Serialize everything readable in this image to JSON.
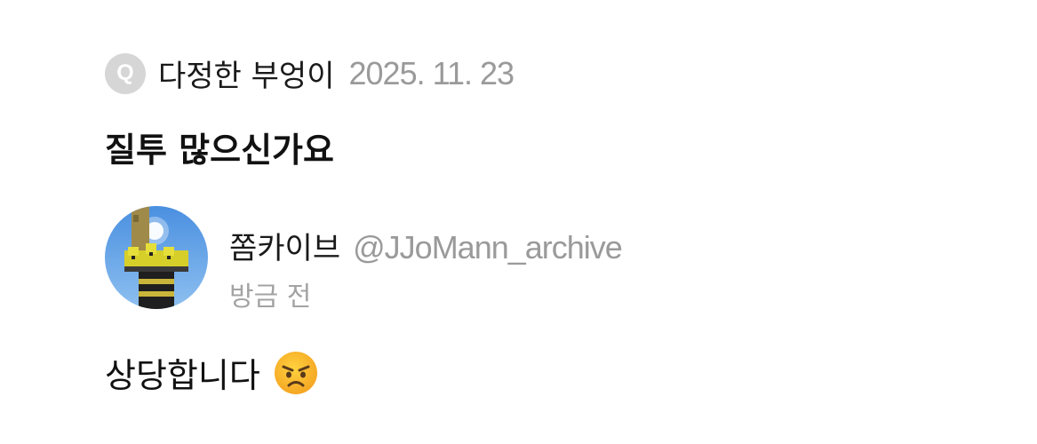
{
  "question": {
    "badge_letter": "Q",
    "author": "다정한 부엉이",
    "date": "2025. 11. 23",
    "text": "질투 많으신가요"
  },
  "answer": {
    "author_name": "쫌카이브",
    "handle": "@JJoMann_archive",
    "time": "방금 전",
    "text": "상당합니다",
    "emoji": "angry-face-icon"
  },
  "colors": {
    "badge": "#d6d6d6",
    "muted_text": "#9a9a9a",
    "body_text": "#111111"
  }
}
